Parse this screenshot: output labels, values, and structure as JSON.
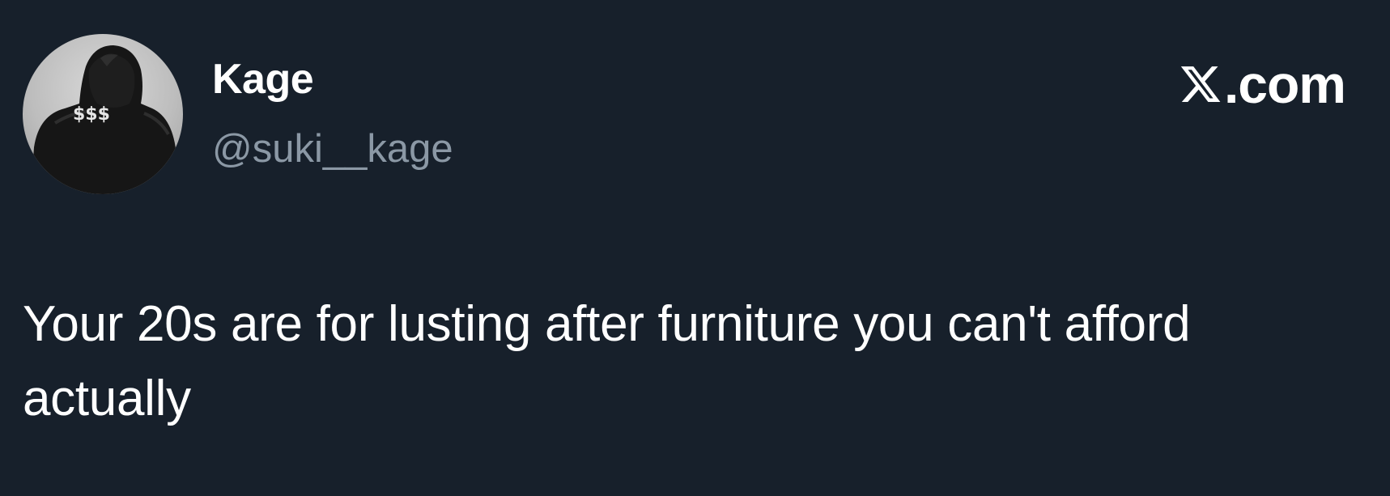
{
  "tweet": {
    "author": {
      "display_name": "Kage",
      "handle": "@suki__kage",
      "avatar": {
        "icon": "hooded-figure-avatar",
        "hoodie_text": "$$$"
      }
    },
    "brand": {
      "icon": "x-logo-icon",
      "text": ".com"
    },
    "text": "Your 20s are for lusting after furniture you can't afford actually"
  },
  "colors": {
    "background": "#17202b",
    "primary_text": "#ffffff",
    "secondary_text": "#8b98a5"
  }
}
